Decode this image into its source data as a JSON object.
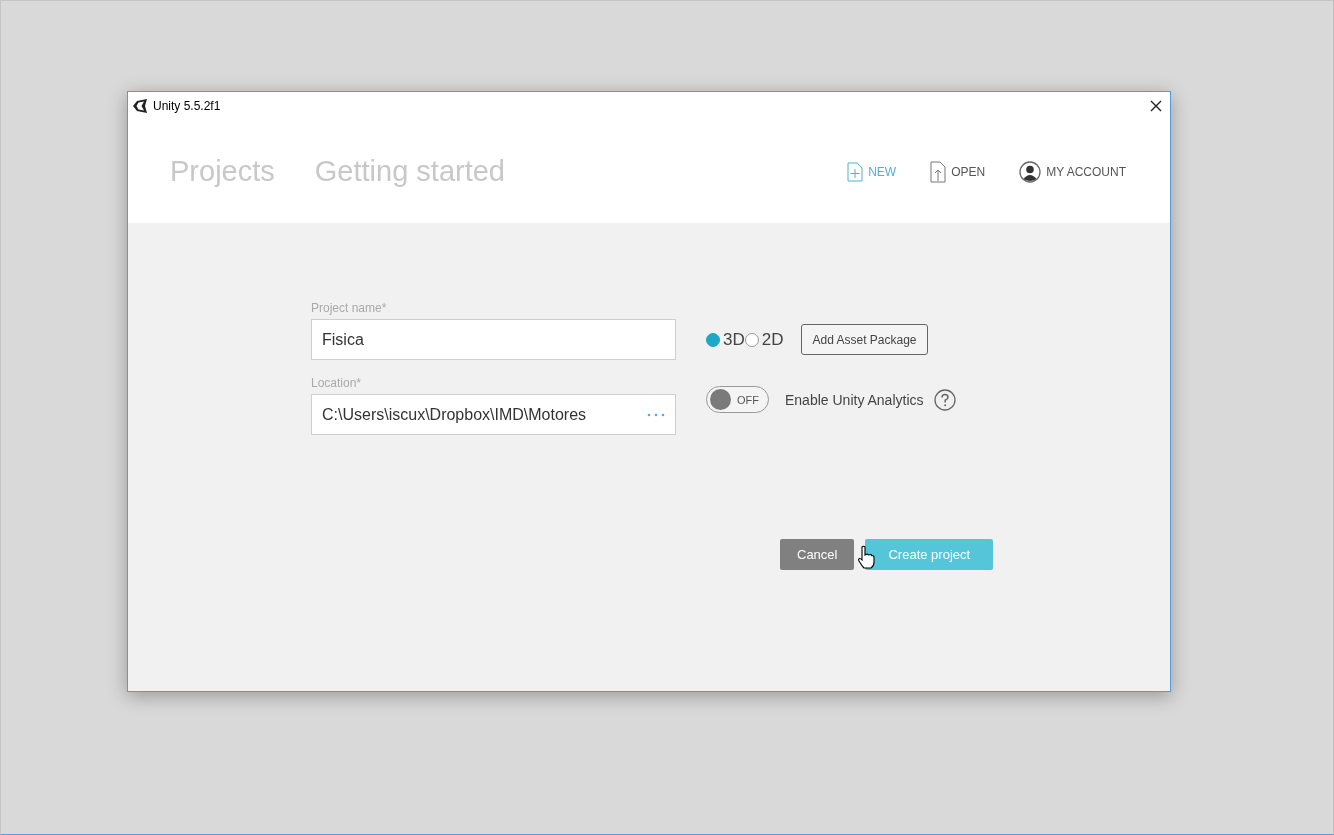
{
  "window": {
    "title": "Unity 5.5.2f1"
  },
  "tabs": [
    {
      "label": "Projects"
    },
    {
      "label": "Getting started"
    }
  ],
  "actions": [
    {
      "label": "NEW",
      "kind": "new",
      "selected": true
    },
    {
      "label": "OPEN",
      "kind": "open",
      "selected": false
    },
    {
      "label": "MY ACCOUNT",
      "kind": "account",
      "selected": false
    }
  ],
  "project_name": {
    "label": "Project name*",
    "value": "Fisica"
  },
  "location": {
    "label": "Location*",
    "value": "C:\\Users\\iscux\\Dropbox\\IMD\\Motores"
  },
  "template": [
    {
      "label": "3D",
      "selected": true
    },
    {
      "label": "2D",
      "selected": false
    }
  ],
  "asset_button": "Add Asset Package",
  "analytics": {
    "on": false,
    "state_label": "OFF",
    "label": "Enable Unity Analytics"
  },
  "buttons": [
    {
      "label": "Cancel",
      "kind": "secondary"
    },
    {
      "label": "Create project",
      "kind": "primary"
    }
  ]
}
